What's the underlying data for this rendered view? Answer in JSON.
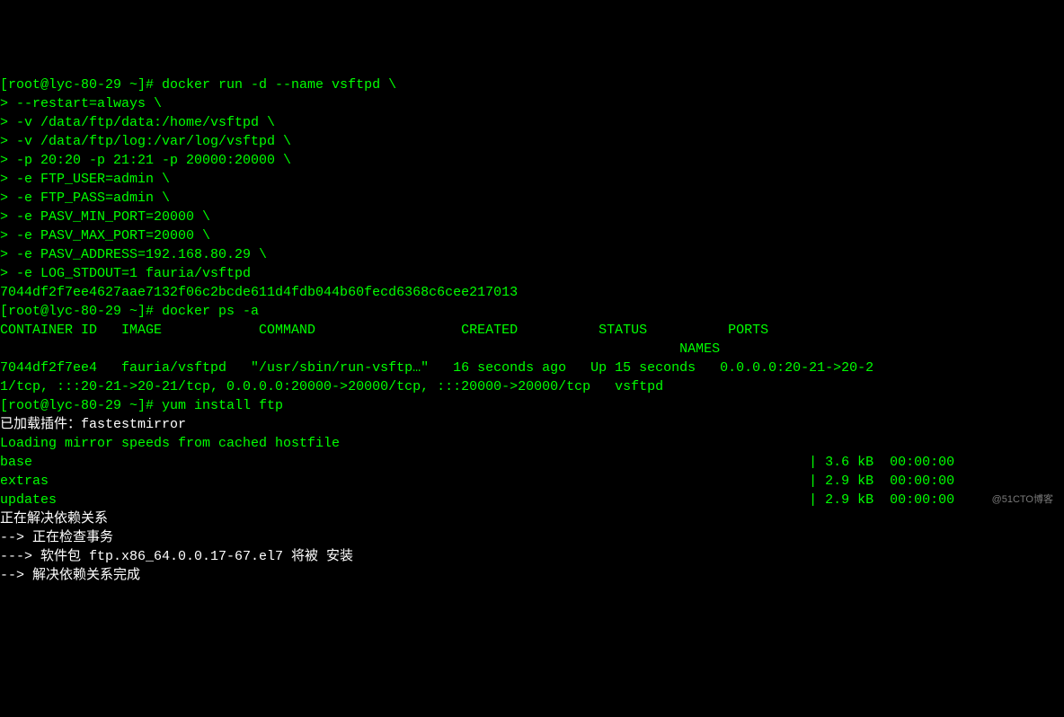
{
  "terminal": {
    "lines": [
      {
        "cls": "green",
        "text": "[root@lyc-80-29 ~]# docker run -d --name vsftpd \\"
      },
      {
        "cls": "green",
        "text": "> --restart=always \\"
      },
      {
        "cls": "green",
        "text": "> -v /data/ftp/data:/home/vsftpd \\"
      },
      {
        "cls": "green",
        "text": "> -v /data/ftp/log:/var/log/vsftpd \\"
      },
      {
        "cls": "green",
        "text": "> -p 20:20 -p 21:21 -p 20000:20000 \\"
      },
      {
        "cls": "green",
        "text": "> -e FTP_USER=admin \\"
      },
      {
        "cls": "green",
        "text": "> -e FTP_PASS=admin \\"
      },
      {
        "cls": "green",
        "text": "> -e PASV_MIN_PORT=20000 \\"
      },
      {
        "cls": "green",
        "text": "> -e PASV_MAX_PORT=20000 \\"
      },
      {
        "cls": "green",
        "text": "> -e PASV_ADDRESS=192.168.80.29 \\"
      },
      {
        "cls": "green",
        "text": "> -e LOG_STDOUT=1 fauria/vsftpd"
      },
      {
        "cls": "green",
        "text": "7044df2f7ee4627aae7132f06c2bcde611d4fdb044b60fecd6368c6cee217013"
      },
      {
        "cls": "green",
        "text": "[root@lyc-80-29 ~]# docker ps -a"
      },
      {
        "cls": "green",
        "text": "CONTAINER ID   IMAGE            COMMAND                  CREATED          STATUS          PORTS"
      },
      {
        "cls": "green",
        "text": "                                                                                    NAMES"
      },
      {
        "cls": "green",
        "text": "7044df2f7ee4   fauria/vsftpd   \"/usr/sbin/run-vsftp…\"   16 seconds ago   Up 15 seconds   0.0.0.0:20-21->20-2"
      },
      {
        "cls": "green",
        "text": "1/tcp, :::20-21->20-21/tcp, 0.0.0.0:20000->20000/tcp, :::20000->20000/tcp   vsftpd"
      },
      {
        "cls": "green",
        "text": "[root@lyc-80-29 ~]# yum install ftp"
      },
      {
        "cls": "white",
        "text": "已加载插件：fastestmirror"
      },
      {
        "cls": "green",
        "text": "Loading mirror speeds from cached hostfile"
      },
      {
        "cls": "green",
        "text": "base                                                                                                | 3.6 kB  00:00:00"
      },
      {
        "cls": "green",
        "text": "extras                                                                                              | 2.9 kB  00:00:00"
      },
      {
        "cls": "green",
        "text": "updates                                                                                             | 2.9 kB  00:00:00"
      },
      {
        "cls": "white",
        "text": "正在解决依赖关系"
      },
      {
        "cls": "white",
        "text": "--> 正在检查事务"
      },
      {
        "cls": "white",
        "text": "---> 软件包 ftp.x86_64.0.0.17-67.el7 将被 安装"
      },
      {
        "cls": "white",
        "text": "--> 解决依赖关系完成"
      }
    ]
  },
  "watermark": "@51CTO博客"
}
